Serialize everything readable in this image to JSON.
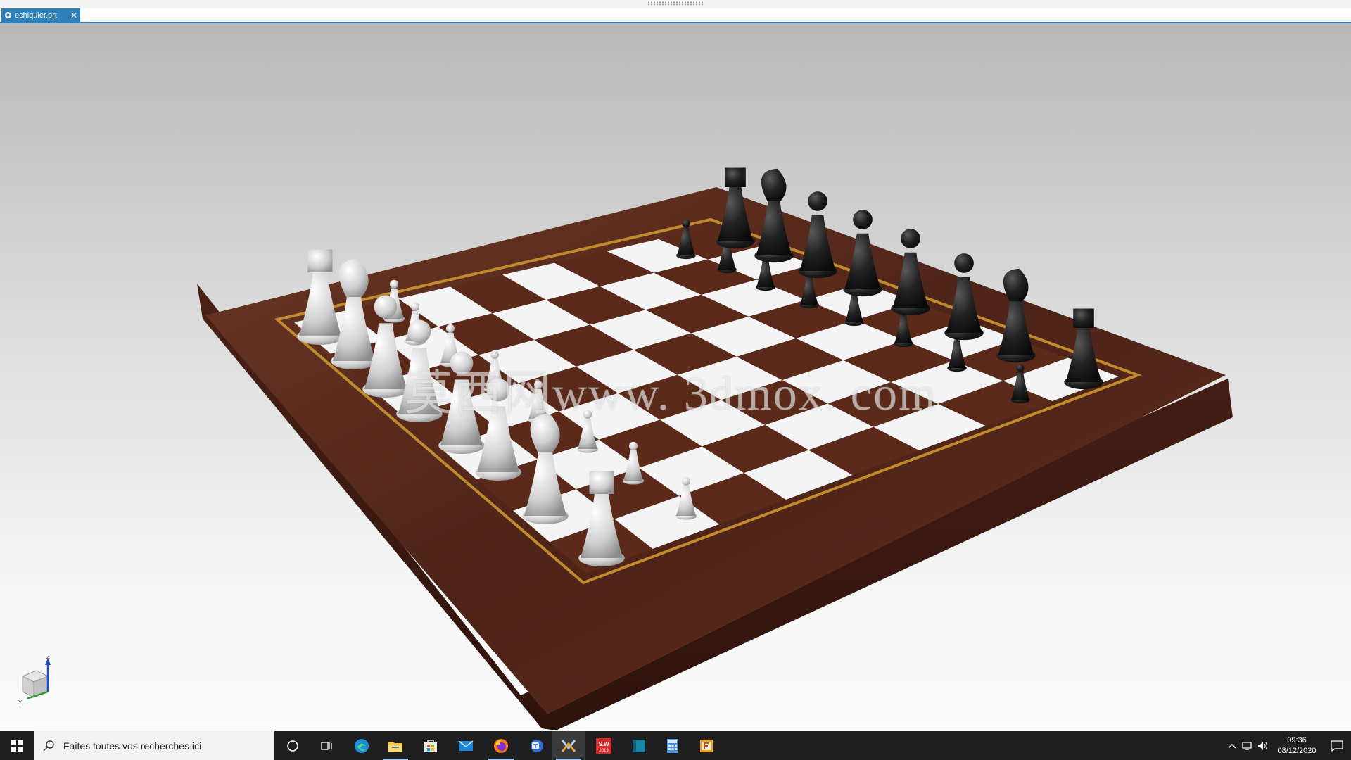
{
  "document_tab": {
    "label": "echiquier.prt",
    "close": "✕"
  },
  "watermark": "莫西网www. 3dmox. com",
  "triad": {
    "z": "Z",
    "y": "Y"
  },
  "taskbar": {
    "search_placeholder": "Faites toutes vos recherches ici",
    "icons": [
      "windows-start-icon",
      "cortana-icon",
      "task-view-icon",
      "edge-icon",
      "file-explorer-icon",
      "store-icon",
      "mail-icon",
      "firefox-icon",
      "teams-icon",
      "nx-icon",
      "solidworks-icon",
      "app-blue-icon",
      "calculator-icon",
      "app-orange-icon"
    ],
    "solidworks_badge": "S.W\n2019",
    "clock_time": "09:36",
    "clock_date": "08/12/2020"
  },
  "colors": {
    "accent": "#2f7fb8",
    "board_wood": "#5a2d1f",
    "board_dark_square": "#5b2a1a",
    "board_light_square": "#f4f4f4",
    "inlay": "#c08a2e",
    "white_piece": "#d9d9d9",
    "black_piece": "#1d1d1d",
    "taskbar": "#1f1f1f"
  }
}
